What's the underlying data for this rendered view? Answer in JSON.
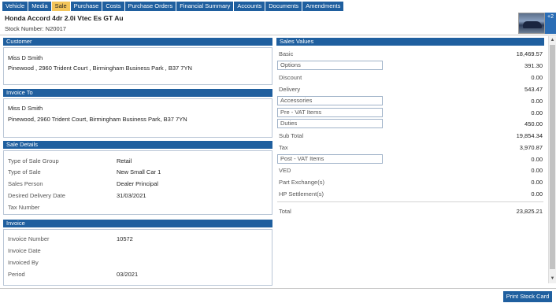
{
  "tabs": [
    {
      "label": "Vehicle"
    },
    {
      "label": "Media"
    },
    {
      "label": "Sale"
    },
    {
      "label": "Purchase"
    },
    {
      "label": "Costs"
    },
    {
      "label": "Purchase Orders"
    },
    {
      "label": "Financial Summary"
    },
    {
      "label": "Accounts"
    },
    {
      "label": "Documents"
    },
    {
      "label": "Amendments"
    }
  ],
  "header": {
    "title": "Honda Accord 4dr 2.0i Vtec Es GT Au",
    "stock_number": "Stock Number: N20017",
    "media_count": "+2"
  },
  "customer": {
    "heading": "Customer",
    "name": "Miss D Smith",
    "address": "Pinewood , 2960 Trident Court , Birmingham Business Park , B37 7YN"
  },
  "invoice_to": {
    "heading": "Invoice To",
    "name": "Miss D Smith",
    "address": "Pinewood, 2960 Trident Court, Birmingham Business Park, B37 7YN"
  },
  "sale_details": {
    "heading": "Sale Details",
    "rows": [
      {
        "label": "Type of Sale Group",
        "value": "Retail"
      },
      {
        "label": "Type of Sale",
        "value": "New Small Car 1"
      },
      {
        "label": "Sales Person",
        "value": "Dealer Principal"
      },
      {
        "label": "Desired Delivery Date",
        "value": "31/03/2021"
      },
      {
        "label": "Tax Number",
        "value": ""
      }
    ]
  },
  "invoice": {
    "heading": "Invoice",
    "rows": [
      {
        "label": "Invoice Number",
        "value": "10572"
      },
      {
        "label": "Invoice Date",
        "value": ""
      },
      {
        "label": "Invoiced By",
        "value": ""
      },
      {
        "label": "Period",
        "value": "03/2021"
      }
    ]
  },
  "sales_values": {
    "heading": "Sales Values",
    "rows": [
      {
        "label": "Basic",
        "value": "18,469.57"
      },
      {
        "label": "Options",
        "value": "391.30"
      },
      {
        "label": "Discount",
        "value": "0.00"
      },
      {
        "label": "Delivery",
        "value": "543.47"
      },
      {
        "label": "Accessories",
        "value": "0.00"
      },
      {
        "label": "Pre - VAT Items",
        "value": "0.00"
      },
      {
        "label": "Duties",
        "value": "450.00"
      },
      {
        "label": "Sub Total",
        "value": "19,854.34"
      },
      {
        "label": "Tax",
        "value": "3,970.87"
      },
      {
        "label": "Post - VAT Items",
        "value": "0.00"
      },
      {
        "label": "VED",
        "value": "0.00"
      },
      {
        "label": "Part Exchange(s)",
        "value": "0.00"
      },
      {
        "label": "HP Settlement(s)",
        "value": "0.00"
      },
      {
        "label": "Total",
        "value": "23,825.21"
      }
    ]
  },
  "footer": {
    "print_label": "Print Stock Card"
  },
  "colors": {
    "tab_bg": "#1f5f9f",
    "tab_active_bg": "#f3c55a",
    "panel_header_bg": "#1f5f9f"
  }
}
